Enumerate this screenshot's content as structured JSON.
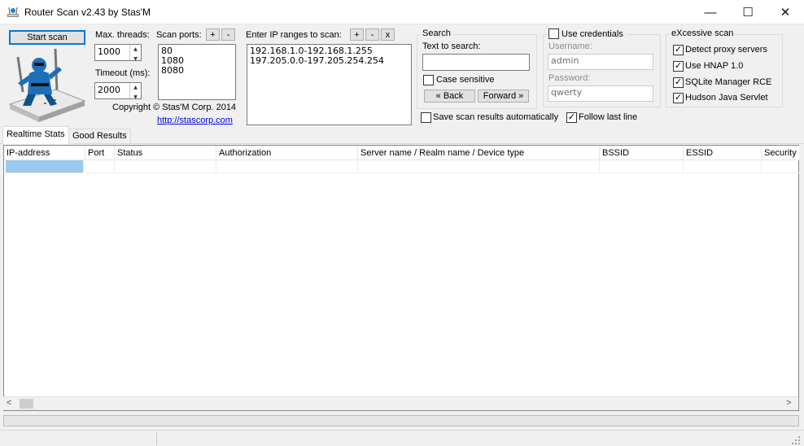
{
  "window": {
    "title": "Router Scan v2.43 by Stas'M",
    "minimize": "—",
    "maximize": "☐",
    "close": "✕"
  },
  "toolbar": {
    "start_scan": "Start scan",
    "max_threads_label": "Max. threads:",
    "max_threads_value": "1000",
    "timeout_label": "Timeout (ms):",
    "timeout_value": "2000",
    "scan_ports_label": "Scan ports:",
    "ports": [
      "80",
      "1080",
      "8080"
    ],
    "ip_ranges_label": "Enter IP ranges to scan:",
    "ip_ranges": [
      "192.168.1.0-192.168.1.255",
      "197.205.0.0-197.205.254.254"
    ],
    "add_btn": "+",
    "remove_btn": "-",
    "clear_btn": "x",
    "copyright": "Copyright © Stas'M Corp. 2014",
    "website": "http://stascorp.com"
  },
  "search": {
    "group_title": "Search",
    "text_label": "Text to search:",
    "text_value": "",
    "case_sensitive": "Case sensitive",
    "back": "« Back",
    "forward": "Forward »"
  },
  "credentials": {
    "use_label": "Use credentials",
    "username_label": "Username:",
    "username_value": "admin",
    "password_label": "Password:",
    "password_value": "qwerty"
  },
  "excessive": {
    "group_title": "eXcessive scan",
    "items": [
      {
        "label": "Detect proxy servers",
        "checked": true
      },
      {
        "label": "Use HNAP 1.0",
        "checked": true
      },
      {
        "label": "SQLite Manager RCE",
        "checked": true
      },
      {
        "label": "Hudson Java Servlet",
        "checked": true
      }
    ]
  },
  "options": {
    "save_auto": "Save scan results automatically",
    "follow_last": "Follow last line"
  },
  "tabs": [
    "Realtime Stats",
    "Good Results"
  ],
  "table": {
    "columns": [
      "IP-address",
      "Port",
      "Status",
      "Authorization",
      "Server name / Realm name / Device type",
      "BSSID",
      "ESSID",
      "Security"
    ]
  },
  "scroll": {
    "left": "<",
    "right": ">"
  },
  "colors": {
    "accent": "#0078d7",
    "selection": "#99c9ef",
    "link": "#0000ee"
  }
}
